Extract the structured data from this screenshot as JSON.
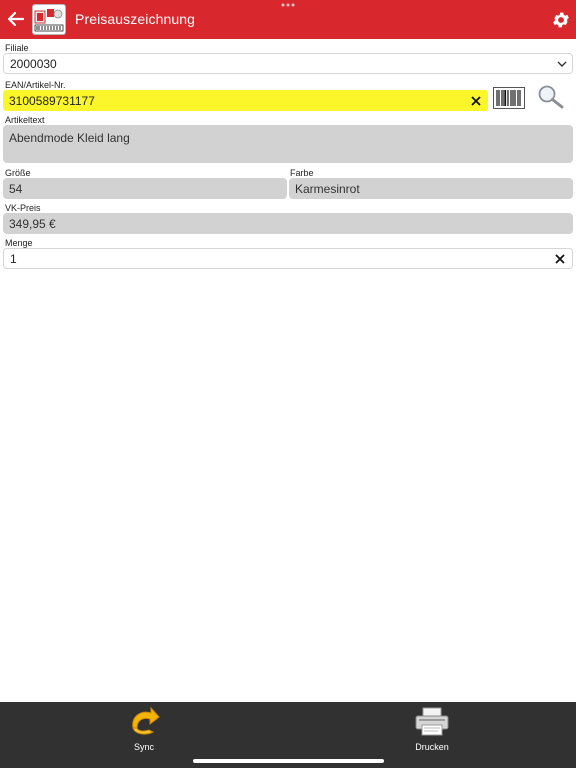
{
  "header": {
    "title": "Preisauszeichnung",
    "back_icon": "arrow-left-icon",
    "settings_icon": "gear-icon",
    "color": "#d9272e"
  },
  "form": {
    "filiale": {
      "label": "Filiale",
      "value": "2000030"
    },
    "ean": {
      "label": "EAN/Artikel-Nr.",
      "value": "3100589731177",
      "highlight": "#fbf62a"
    },
    "artikeltext": {
      "label": "Artikeltext",
      "value": "Abendmode Kleid lang"
    },
    "groesse": {
      "label": "Größe",
      "value": "54"
    },
    "farbe": {
      "label": "Farbe",
      "value": "Karmesinrot"
    },
    "vkpreis": {
      "label": "VK-Preis",
      "value": "349,95 €"
    },
    "menge": {
      "label": "Menge",
      "value": "1"
    }
  },
  "bottom_bar": {
    "sync_label": "Sync",
    "print_label": "Drucken"
  }
}
